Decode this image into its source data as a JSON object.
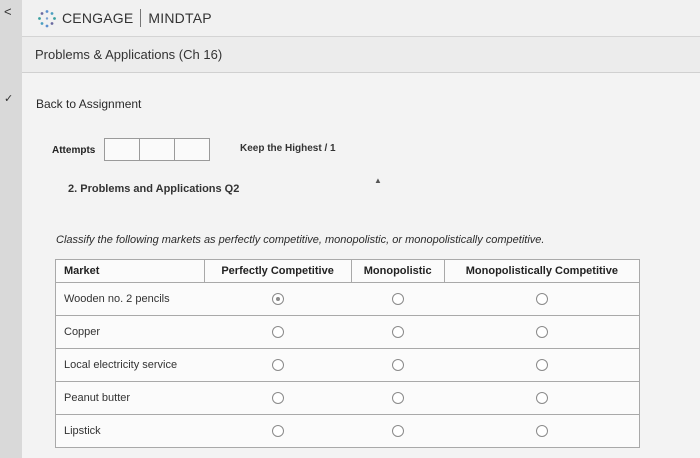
{
  "sidebar": {
    "collapse_glyph": "<",
    "check_glyph": "✓"
  },
  "header": {
    "brand": "CENGAGE",
    "product": "MINDTAP"
  },
  "page": {
    "title": "Problems & Applications (Ch 16)"
  },
  "assignment": {
    "back_link": "Back to Assignment",
    "attempts_label": "Attempts",
    "keep_label": "Keep the Highest / 1",
    "question_heading": "2. Problems and Applications Q2",
    "instructions": "Classify the following markets as perfectly competitive, monopolistic, or monopolistically competitive."
  },
  "table": {
    "headers": [
      "Market",
      "Perfectly Competitive",
      "Monopolistic",
      "Monopolistically Competitive"
    ],
    "rows": [
      "Wooden no. 2 pencils",
      "Copper",
      "Local electricity service",
      "Peanut butter",
      "Lipstick"
    ]
  }
}
